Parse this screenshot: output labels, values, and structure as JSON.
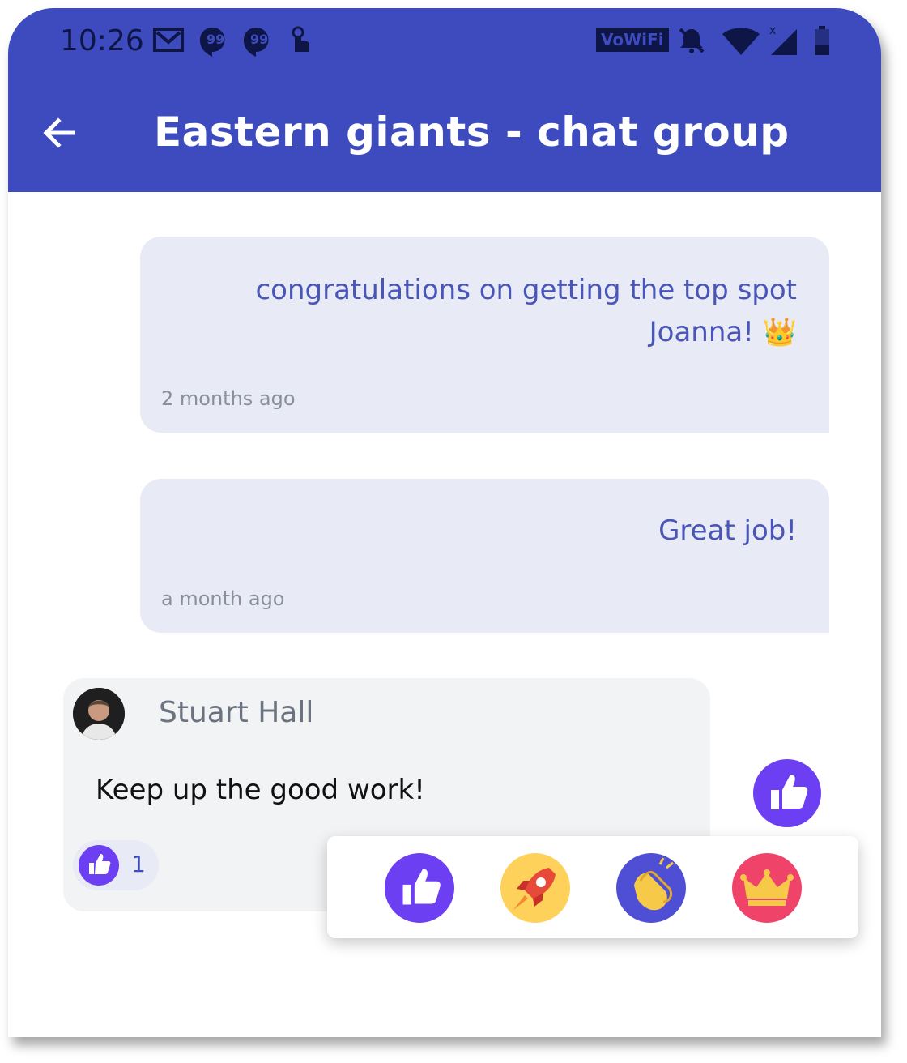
{
  "status_bar": {
    "time": "10:26",
    "left_icons": [
      "gmail-icon",
      "hangouts-icon",
      "hangouts-icon",
      "touch-icon"
    ],
    "vowifi_label": "VoWiFi",
    "right_icons": [
      "vowifi-icon",
      "bell-off-icon",
      "wifi-icon",
      "signal-icon",
      "battery-icon"
    ]
  },
  "toolbar": {
    "title": "Eastern giants - chat group",
    "back_icon": "arrow-back-icon"
  },
  "messages": [
    {
      "line1": "congratulations on getting the top spot",
      "line2": "Joanna! 👑",
      "time": "2 months ago"
    },
    {
      "line1": "Great job!",
      "time": "a month ago"
    }
  ],
  "incoming": {
    "sender": "Stuart Hall",
    "text": "Keep up the good work!",
    "reaction_count": "1",
    "reaction_icon": "thumbs-up-icon"
  },
  "reaction_picker": [
    "thumbs-up-icon",
    "rocket-icon",
    "clapping-hands-icon",
    "crown-icon"
  ],
  "colors": {
    "appbar": "#3d4bbe",
    "outgoing_bubble": "#e8eaf6",
    "outgoing_text": "#4a55b8",
    "incoming_bubble": "#f2f3f5",
    "like_purple": "#6c3ff2"
  }
}
